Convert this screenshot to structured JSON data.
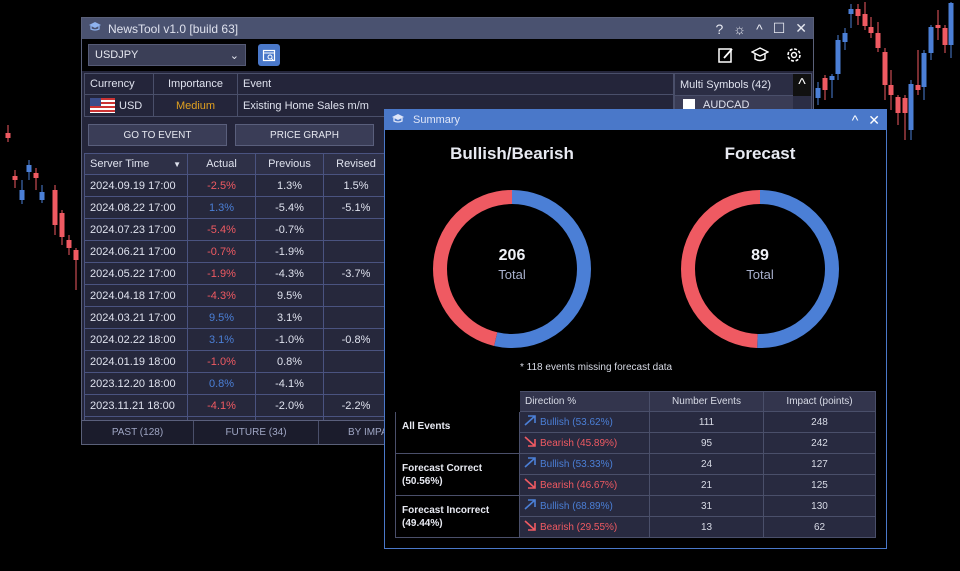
{
  "colors": {
    "bullish": "#4b7fd6",
    "bearish": "#ef5a62",
    "accent": "#4a78c9",
    "medium": "#e0a020"
  },
  "main_window": {
    "title": "NewsTool v1.0 [build 63]",
    "title_icon": "graduation-cap-icon",
    "controls": [
      "help-icon",
      "theme-sun-icon",
      "minimize-caret-icon",
      "maximize-icon",
      "close-icon"
    ],
    "symbol_select": {
      "value": "USDJPY"
    },
    "toolbar_icons": [
      "calendar-search-icon",
      "edit-icon",
      "graduation-cap-icon",
      "gear-icon"
    ],
    "event_header": {
      "columns": [
        "Currency",
        "Importance",
        "Event"
      ],
      "row": {
        "currency": "USD",
        "importance": "Medium",
        "event": "Existing Home Sales m/m"
      }
    },
    "multi_symbols": {
      "header": "Multi Symbols (42)",
      "items": [
        {
          "label": "AUDCAD",
          "checked": false
        }
      ]
    },
    "buttons": {
      "go_to_event": "GO TO EVENT",
      "price_graph": "PRICE GRAPH"
    },
    "table": {
      "columns": [
        "Server Time",
        "Actual",
        "Previous",
        "Revised"
      ],
      "rows": [
        {
          "time": "2024.09.19 17:00",
          "actual": "-2.5%",
          "dir": "neg",
          "previous": "1.3%",
          "revised": "1.5%"
        },
        {
          "time": "2024.08.22 17:00",
          "actual": "1.3%",
          "dir": "pos",
          "previous": "-5.4%",
          "revised": "-5.1%"
        },
        {
          "time": "2024.07.23 17:00",
          "actual": "-5.4%",
          "dir": "neg",
          "previous": "-0.7%",
          "revised": ""
        },
        {
          "time": "2024.06.21 17:00",
          "actual": "-0.7%",
          "dir": "neg",
          "previous": "-1.9%",
          "revised": ""
        },
        {
          "time": "2024.05.22 17:00",
          "actual": "-1.9%",
          "dir": "neg",
          "previous": "-4.3%",
          "revised": "-3.7%"
        },
        {
          "time": "2024.04.18 17:00",
          "actual": "-4.3%",
          "dir": "neg",
          "previous": "9.5%",
          "revised": ""
        },
        {
          "time": "2024.03.21 17:00",
          "actual": "9.5%",
          "dir": "pos",
          "previous": "3.1%",
          "revised": ""
        },
        {
          "time": "2024.02.22 18:00",
          "actual": "3.1%",
          "dir": "pos",
          "previous": "-1.0%",
          "revised": "-0.8%"
        },
        {
          "time": "2024.01.19 18:00",
          "actual": "-1.0%",
          "dir": "neg",
          "previous": "0.8%",
          "revised": ""
        },
        {
          "time": "2023.12.20 18:00",
          "actual": "0.8%",
          "dir": "pos",
          "previous": "-4.1%",
          "revised": ""
        },
        {
          "time": "2023.11.21 18:00",
          "actual": "-4.1%",
          "dir": "neg",
          "previous": "-2.0%",
          "revised": "-2.2%"
        }
      ]
    },
    "tabs": [
      "PAST (128)",
      "FUTURE (34)",
      "BY IMPACT"
    ]
  },
  "summary_window": {
    "title": "Summary",
    "bullish_bearish": {
      "title": "Bullish/Bearish",
      "total": "206",
      "total_label": "Total",
      "bullish_share": 0.5362,
      "bearish_share": 0.4638
    },
    "forecast": {
      "title": "Forecast",
      "total": "89",
      "total_label": "Total",
      "correct_share": 0.5056,
      "incorrect_share": 0.4944
    },
    "note": "* 118 events missing forecast data",
    "stats_table": {
      "columns": [
        "Direction %",
        "Number Events",
        "Impact (points)"
      ],
      "groups": [
        {
          "label": "All Events",
          "rows": [
            {
              "direction": "Bullish (53.62%)",
              "type": "bull",
              "events": "111",
              "impact": "248"
            },
            {
              "direction": "Bearish (45.89%)",
              "type": "bear",
              "events": "95",
              "impact": "242"
            }
          ]
        },
        {
          "label": "Forecast Correct (50.56%)",
          "rows": [
            {
              "direction": "Bullish (53.33%)",
              "type": "bull",
              "events": "24",
              "impact": "127"
            },
            {
              "direction": "Bearish (46.67%)",
              "type": "bear",
              "events": "21",
              "impact": "125"
            }
          ]
        },
        {
          "label": "Forecast Incorrect (49.44%)",
          "rows": [
            {
              "direction": "Bullish (68.89%)",
              "type": "bull",
              "events": "31",
              "impact": "130"
            },
            {
              "direction": "Bearish (29.55%)",
              "type": "bear",
              "events": "13",
              "impact": "62"
            }
          ]
        }
      ]
    }
  }
}
